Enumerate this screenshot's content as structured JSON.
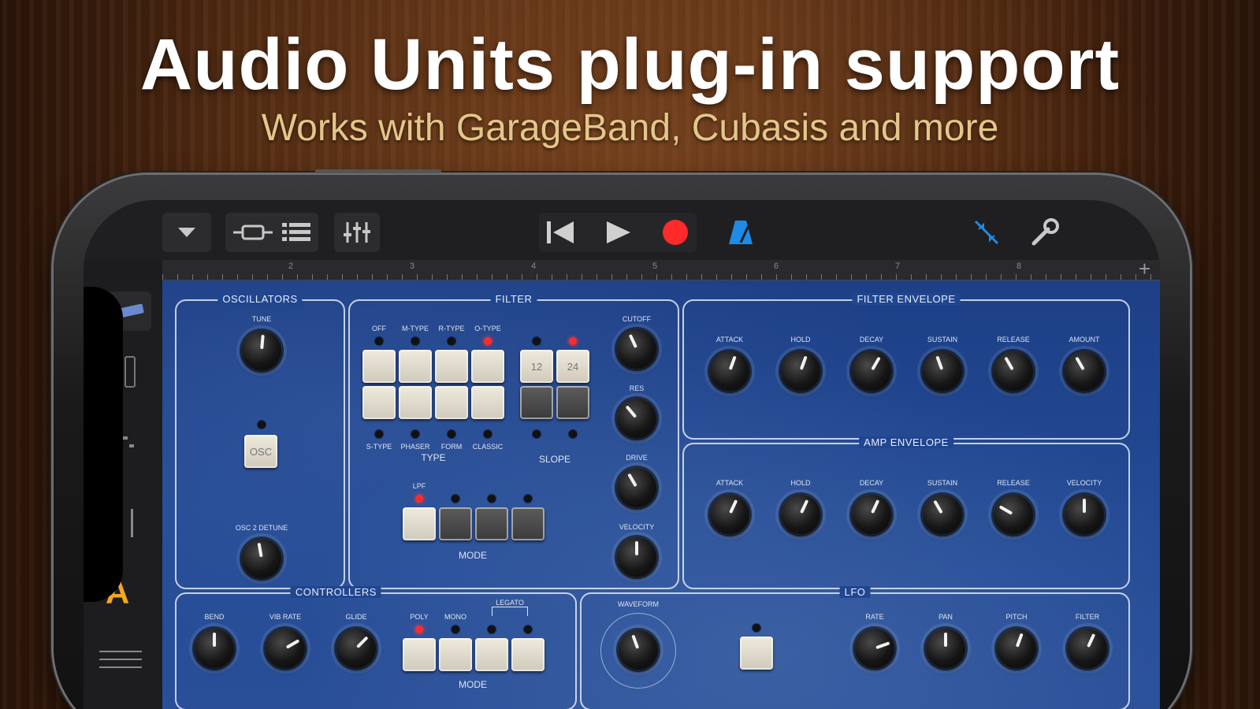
{
  "headline": "Audio Units plug-in support",
  "subline": "Works with GarageBand, Cubasis and more",
  "toolbar": {
    "dropdown_icon": "triangle-down-icon",
    "loop_icon": "loop-browser-icon",
    "tracks_icon": "tracks-view-icon",
    "mixer_icon": "mixer-icon",
    "rewind_icon": "skip-back-icon",
    "play_icon": "play-icon",
    "record_icon": "record-icon",
    "metronome_icon": "metronome-icon",
    "smart_icon": "smart-controls-icon",
    "settings_icon": "wrench-icon"
  },
  "ruler": {
    "marks": [
      "2",
      "3",
      "4",
      "5",
      "6",
      "7",
      "8"
    ],
    "add": "+"
  },
  "sidebar": {
    "instrument_letter": "A"
  },
  "colors": {
    "panel": "#234a94",
    "led_on": "#ff2a2a",
    "record": "#ff2a2a",
    "metronome": "#1e8be6",
    "accent_letter": "#f5a623"
  },
  "synth": {
    "oscillators": {
      "title": "OSCILLATORS",
      "tune": "TUNE",
      "osc2_detune": "OSC 2 DETUNE",
      "osc_button": "OSC"
    },
    "filter": {
      "title": "FILTER",
      "type_labels_top": [
        "OFF",
        "M-TYPE",
        "R-TYPE",
        "O-TYPE"
      ],
      "type_labels_bottom": [
        "S-TYPE",
        "PHASER",
        "FORM",
        "CLASSIC"
      ],
      "type_title": "TYPE",
      "slope_buttons": [
        "12",
        "24"
      ],
      "slope_title": "SLOPE",
      "mode_top": [
        "LPF",
        "",
        "",
        ""
      ],
      "mode_title": "MODE",
      "cutoff": "CUTOFF",
      "res": "RES",
      "drive": "DRIVE",
      "velocity": "VELOCITY"
    },
    "filter_envelope": {
      "title": "FILTER ENVELOPE",
      "labels": [
        "ATTACK",
        "HOLD",
        "DECAY",
        "SUSTAIN",
        "RELEASE",
        "AMOUNT"
      ]
    },
    "amp_envelope": {
      "title": "AMP ENVELOPE",
      "labels": [
        "ATTACK",
        "HOLD",
        "DECAY",
        "SUSTAIN",
        "RELEASE",
        "VELOCITY"
      ]
    },
    "controllers": {
      "title": "CONTROLLERS",
      "labels": [
        "BEND",
        "VIB RATE",
        "GLIDE"
      ],
      "mode_labels": [
        "POLY",
        "MONO",
        "LEGATO"
      ],
      "mode_title": "MODE"
    },
    "lfo": {
      "title": "LFO",
      "waveform": "WAVEFORM",
      "labels": [
        "RATE",
        "PAN",
        "PITCH",
        "FILTER"
      ]
    }
  }
}
